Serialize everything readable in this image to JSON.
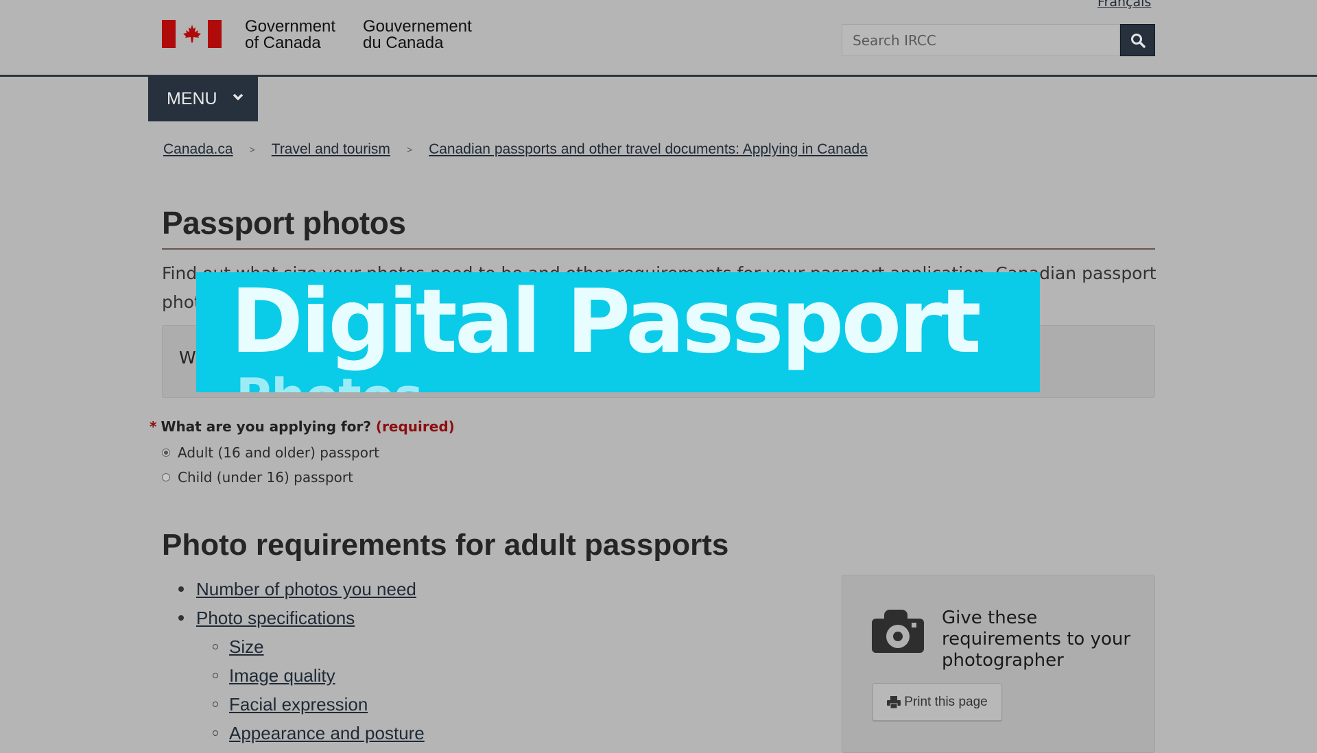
{
  "header": {
    "signature_en_line1": "Government",
    "signature_en_line2": "of Canada",
    "signature_fr_line1": "Gouvernement",
    "signature_fr_line2": "du Canada",
    "language_link": "Français",
    "search_placeholder": "Search IRCC",
    "search_icon": "search-icon"
  },
  "menu": {
    "label": "MENU",
    "icon": "chevron-down-icon"
  },
  "breadcrumb": [
    {
      "label": "Canada.ca"
    },
    {
      "label": "Travel and tourism"
    },
    {
      "label": "Canadian passports and other travel documents: Applying in Canada"
    }
  ],
  "breadcrumb_separator": ">",
  "page": {
    "title": "Passport photos",
    "intro_line1": "Find out what size your photos need to be and other requirements for your passport application. Canadian passport",
    "intro_line2": "phot",
    "infobox_text": "W"
  },
  "overlay": {
    "title": "Digital Passport",
    "subtitle": "Photos",
    "background": "#0acbe8"
  },
  "form": {
    "question": "What are you applying for?",
    "required_marker": "*",
    "required_label": "(required)",
    "options": [
      {
        "label": "Adult (16 and older) passport",
        "selected": true
      },
      {
        "label": "Child (under 16) passport",
        "selected": false
      }
    ]
  },
  "section": {
    "title": "Photo requirements for adult passports",
    "links": [
      {
        "label": "Number of photos you need",
        "level": 1
      },
      {
        "label": "Photo specifications",
        "level": 1
      },
      {
        "label": "Size",
        "level": 2
      },
      {
        "label": "Image quality",
        "level": 2
      },
      {
        "label": "Facial expression",
        "level": 2
      },
      {
        "label": "Appearance and posture",
        "level": 2
      }
    ]
  },
  "sidebar_card": {
    "icon": "camera-icon",
    "title": "Give these requirements to your photographer",
    "print_button": "Print this page",
    "print_icon": "printer-icon"
  }
}
